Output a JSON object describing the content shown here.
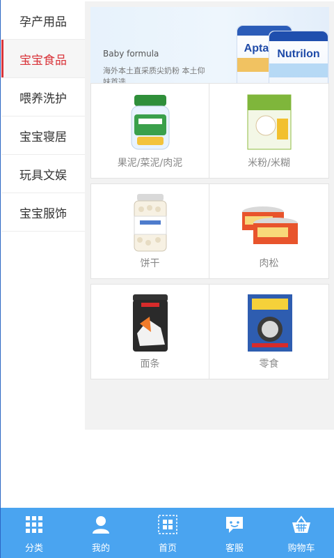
{
  "sidebar": {
    "items": [
      {
        "label": "孕产用品"
      },
      {
        "label": "宝宝食品"
      },
      {
        "label": "喂养洗护"
      },
      {
        "label": "宝宝寝居"
      },
      {
        "label": "玩具文娱"
      },
      {
        "label": "宝宝服饰"
      }
    ],
    "active_index": 1,
    "active_color": "#d9343a"
  },
  "banner": {
    "title": "Baby formula",
    "subtitle": "海外本土直采质尖奶粉 本土仰妹首选",
    "brand1": "Aptamil",
    "brand2": "Nutrilon"
  },
  "categories": [
    {
      "label": "果泥/菜泥/肉泥",
      "icon": "puree-jar-icon"
    },
    {
      "label": "米粉/米糊",
      "icon": "rice-cereal-box-icon"
    },
    {
      "label": "饼干",
      "icon": "biscuit-jar-icon"
    },
    {
      "label": "肉松",
      "icon": "meat-floss-can-icon"
    },
    {
      "label": "面条",
      "icon": "noodle-can-icon"
    },
    {
      "label": "零食",
      "icon": "snack-box-icon"
    }
  ],
  "tabbar": {
    "color": "#4aa4f0",
    "tabs": [
      {
        "label": "分类",
        "icon": "grid-icon"
      },
      {
        "label": "我的",
        "icon": "user-icon"
      },
      {
        "label": "首页",
        "icon": "home-grid-icon"
      },
      {
        "label": "客服",
        "icon": "chat-icon"
      },
      {
        "label": "购物车",
        "icon": "basket-icon"
      }
    ]
  }
}
